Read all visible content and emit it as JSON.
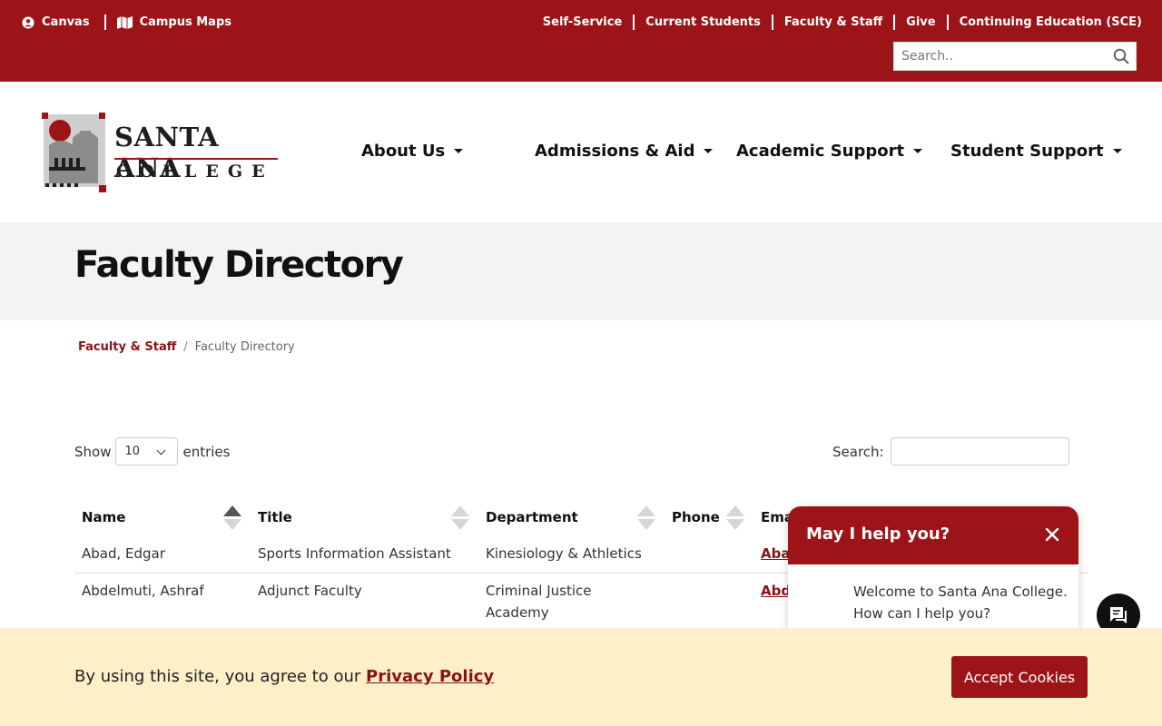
{
  "utility": {
    "left_links": [
      {
        "label": "Canvas",
        "icon": "user-circle-icon"
      },
      {
        "label": "Campus Maps",
        "icon": "map-icon"
      }
    ],
    "right_links": [
      "Self-Service",
      "Current Students",
      "Faculty & Staff",
      "Give",
      "Continuing Education (SCE)"
    ],
    "search_placeholder": "Search.."
  },
  "logo": {
    "line1": "SANTA ANA",
    "line2": "COLLEGE"
  },
  "nav": [
    "About Us",
    "Admissions & Aid",
    "Academic Support",
    "Student Support"
  ],
  "page": {
    "title": "Faculty Directory"
  },
  "breadcrumb": {
    "parent": "Faculty & Staff",
    "current": "Faculty Directory"
  },
  "table_controls": {
    "show_label": "Show",
    "entries_value": "10",
    "entries_label": "entries",
    "search_label": "Search:"
  },
  "table": {
    "columns": [
      "Name",
      "Title",
      "Department",
      "Phone",
      "Ema"
    ],
    "rows": [
      {
        "name": "Abad, Edgar",
        "title": "Sports Information Assistant",
        "department": "Kinesiology & Athletics",
        "phone": "",
        "email": "Aba"
      },
      {
        "name": "Abdelmuti, Ashraf",
        "title": "Adjunct Faculty",
        "department": "Criminal Justice Academy",
        "phone": "",
        "email": "Abd"
      }
    ]
  },
  "chat": {
    "title": "May I help you?",
    "message_line1": "Welcome to Santa Ana College.",
    "message_line2": "How can I help you?"
  },
  "cookie": {
    "message": "By using this site, you agree to our ",
    "link": "Privacy Policy",
    "button": "Accept Cookies"
  },
  "colors": {
    "brand_red": "#9c1418",
    "cookie_bg": "#fdf0c8",
    "band_gray": "#f3f3f3"
  }
}
